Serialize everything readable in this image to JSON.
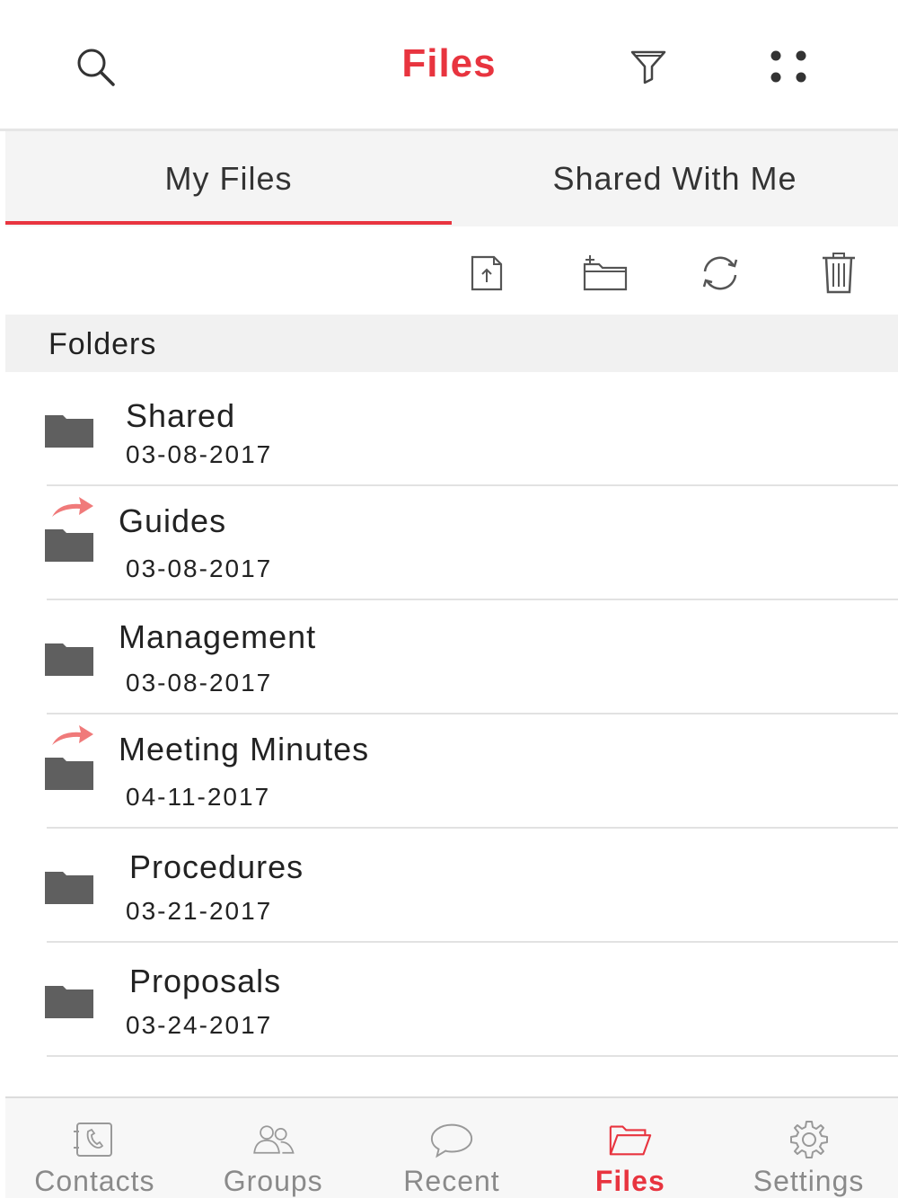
{
  "header": {
    "title": "Files",
    "icons": [
      "search-icon",
      "filter-icon",
      "more-icon"
    ]
  },
  "tabs": [
    {
      "label": "My Files",
      "active": true
    },
    {
      "label": "Shared With Me",
      "active": false
    }
  ],
  "toolbar": {
    "icons": [
      "upload-file-icon",
      "new-folder-icon",
      "refresh-icon",
      "trash-icon"
    ]
  },
  "section": {
    "title": "Folders"
  },
  "folders": [
    {
      "name": "Shared",
      "date": "03-08-2017",
      "shared": false
    },
    {
      "name": "Guides",
      "date": "03-08-2017",
      "shared": true
    },
    {
      "name": "Management",
      "date": "03-08-2017",
      "shared": false
    },
    {
      "name": "Meeting Minutes",
      "date": "04-11-2017",
      "shared": true
    },
    {
      "name": "Procedures",
      "date": "03-21-2017",
      "shared": false
    },
    {
      "name": "Proposals",
      "date": "03-24-2017",
      "shared": false
    }
  ],
  "bottom_nav": [
    {
      "label": "Contacts",
      "icon": "contacts-icon",
      "active": false
    },
    {
      "label": "Groups",
      "icon": "groups-icon",
      "active": false
    },
    {
      "label": "Recent",
      "icon": "chat-bubble-icon",
      "active": false
    },
    {
      "label": "Files",
      "icon": "folder-open-icon",
      "active": true
    },
    {
      "label": "Settings",
      "icon": "gear-icon",
      "active": false
    }
  ],
  "colors": {
    "accent": "#e8343f",
    "folder": "#5f5f5f",
    "shared_arrow": "#f07a7a",
    "inactive_nav": "#8a8a8a"
  }
}
